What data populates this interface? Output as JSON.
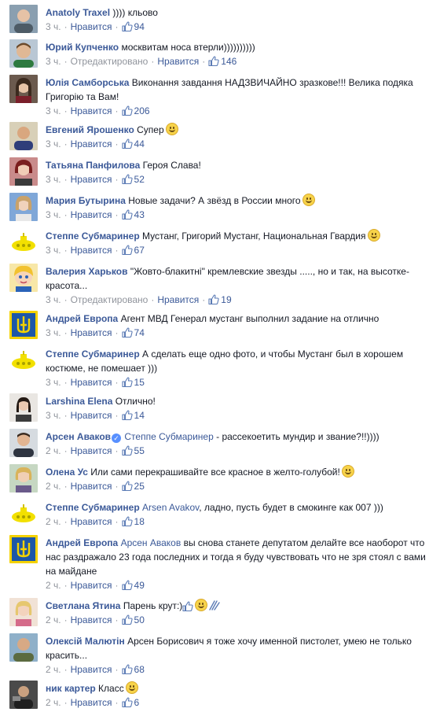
{
  "comments": [
    {
      "author": "Anatoly Traxel",
      "text": ")))) кльово",
      "time": "3 ч.",
      "like_label": "Нравится",
      "likes": "94"
    },
    {
      "author": "Юрий Купченко",
      "text": "москвитам носа втерли))))))))))",
      "time": "3 ч.",
      "edited": "Отредактировано",
      "like_label": "Нравится",
      "likes": "146"
    },
    {
      "author": "Юлія Самборська",
      "text": "Виконання завдання НАДЗВИЧАЙНО зразкове!!! Велика подяка Григорію та Вам!",
      "time": "3 ч.",
      "like_label": "Нравится",
      "likes": "206"
    },
    {
      "author": "Евгений Ярошенко",
      "text": "Супер",
      "time": "3 ч.",
      "like_label": "Нравится",
      "likes": "44"
    },
    {
      "author": "Татьяна Панфилова",
      "text": "Героя Слава!",
      "time": "3 ч.",
      "like_label": "Нравится",
      "likes": "52"
    },
    {
      "author": "Мария Бутырина",
      "text": "Новые задачи? А звёзд в России много",
      "time": "3 ч.",
      "like_label": "Нравится",
      "likes": "43"
    },
    {
      "author": "Степпе Субмаринер",
      "text": "Мустанг, Григорий Мустанг, Национальная Гвардия",
      "time": "3 ч.",
      "like_label": "Нравится",
      "likes": "67"
    },
    {
      "author": "Валерия Харьков",
      "text": "\"Жовто-блакитні\" кремлевские звезды ....., но и так, на высотке- красота...",
      "time": "3 ч.",
      "edited": "Отредактировано",
      "like_label": "Нравится",
      "likes": "19"
    },
    {
      "author": "Андрей Европа",
      "text": "Агент МВД Генерал мустанг выполнил задание на отлично",
      "time": "3 ч.",
      "like_label": "Нравится",
      "likes": "74"
    },
    {
      "author": "Степпе Субмаринер",
      "text": "А сделать еще одно фото, и чтобы Мустанг был в хорошем костюме, не помешает )))",
      "time": "3 ч.",
      "like_label": "Нравится",
      "likes": "15"
    },
    {
      "author": "Larshina Elena",
      "text": "Отлично!",
      "time": "3 ч.",
      "like_label": "Нравится",
      "likes": "14"
    },
    {
      "author": "Арсен Аваков",
      "verified": "✓",
      "mention": "Степпе Субмаринер",
      "text": " - рассекоетить мундир и звание?!!))))",
      "time": "2 ч.",
      "like_label": "Нравится",
      "likes": "55"
    },
    {
      "author": "Олена Ус",
      "text": "Или сами перекрашивайте все красное в желто-голубой!",
      "time": "2 ч.",
      "like_label": "Нравится",
      "likes": "25"
    },
    {
      "author": "Степпе Субмаринер",
      "mention": "Arsen Avakov",
      "text": ", ладно, пусть будет в смокинге как 007 )))",
      "time": "2 ч.",
      "like_label": "Нравится",
      "likes": "18"
    },
    {
      "author": "Андрей Европа",
      "mention": "Арсен Аваков",
      "text": " вы снова станете депутатом делайте все наоборот что нас раздражало 23 года последних и тогда я буду чувствовать что не зря стоял с вами на майдане",
      "time": "2 ч.",
      "like_label": "Нравится",
      "likes": "49"
    },
    {
      "author": "Светлана Ятина",
      "text": "Парень крут:)",
      "time": "2 ч.",
      "like_label": "Нравится",
      "likes": "50"
    },
    {
      "author": "Олексій Малютін",
      "text": "Арсен Борисович я тоже хочу именной пистолет, умею не только красить...",
      "time": "2 ч.",
      "like_label": "Нравится",
      "likes": "68"
    },
    {
      "author": "ник картер",
      "text": "Класс",
      "time": "2 ч.",
      "like_label": "Нравится",
      "likes": "6"
    }
  ],
  "colors": {
    "link": "#3b5998",
    "meta": "#90949c",
    "text": "#141823"
  }
}
